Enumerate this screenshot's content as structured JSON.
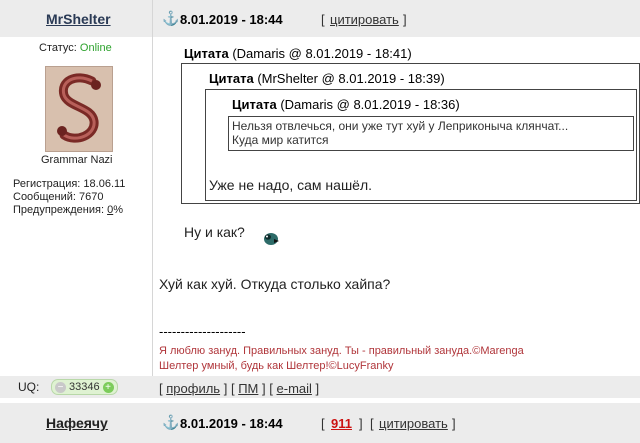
{
  "post1": {
    "username": "MrShelter",
    "anchor_icon": "anchor-icon",
    "date": "8.01.2019 - 18:44",
    "bracket_open": "[",
    "bracket_close": "]",
    "quote_action": "цитировать",
    "status_label": "Статус:",
    "status_value": "Online",
    "status_color": "#2ea32e",
    "user_title": "Grammar Nazi",
    "reg_label": "Регистрация: 18.06.11",
    "msgs_label": "Сообщений: 7670",
    "warn_label": "Предупреждения:",
    "warn_value": "0",
    "warn_suffix": "%",
    "quote_outer": {
      "title": "Цитата",
      "meta": "(Damaris @ 8.01.2019 - 18:41)",
      "reply": "Ну и как?"
    },
    "quote_mid": {
      "title": "Цитата",
      "meta": "(MrShelter @ 8.01.2019 - 18:39)",
      "reply": "Уже не надо, сам нашёл."
    },
    "quote_inner": {
      "title": "Цитата",
      "meta": "(Damaris @ 8.01.2019 - 18:36)",
      "line1": "Нельзя отвлечься, они уже тут хуй у Леприконыча клянчат...",
      "line2": "Куда мир катится"
    },
    "message": "Хуй как хуй. Откуда столько хайпа?",
    "sig_divider": "--------------------",
    "sig_line1": "Я люблю зануд. Правильных зануд. Ты - правильный зануда.©Marenga",
    "sig_line2": "Шелтер умный, будь как Шелтер!©LucyFranky",
    "uq_label": "UQ:",
    "uq_minus": "−",
    "uq_value": "33346",
    "uq_plus": "+",
    "links": [
      "профиль",
      "ПМ",
      "e-mail"
    ]
  },
  "post2": {
    "username": "Нафеячу",
    "anchor_icon": "anchor-icon",
    "date": "8.01.2019 - 18:44",
    "count": "911",
    "count_color": "#cc1111",
    "quote_action": "цитировать"
  }
}
